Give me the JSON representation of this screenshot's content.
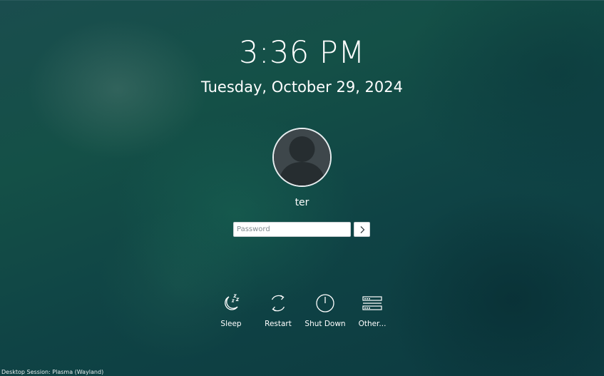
{
  "clock": {
    "time": "3:36 PM",
    "date": "Tuesday, October 29, 2024"
  },
  "user": {
    "name": "ter",
    "avatar_icon": "user-avatar-icon"
  },
  "login": {
    "password_placeholder": "Password",
    "submit_icon": "chevron-right-icon"
  },
  "actions": [
    {
      "label": "Sleep",
      "icon": "sleep-icon"
    },
    {
      "label": "Restart",
      "icon": "restart-icon"
    },
    {
      "label": "Shut Down",
      "icon": "power-icon"
    },
    {
      "label": "Other...",
      "icon": "other-sessions-icon"
    }
  ],
  "footer": {
    "session": "Desktop Session: Plasma (Wayland)"
  },
  "colors": {
    "background": "#113e44",
    "text": "#ffffff",
    "field": "#ffffff"
  }
}
